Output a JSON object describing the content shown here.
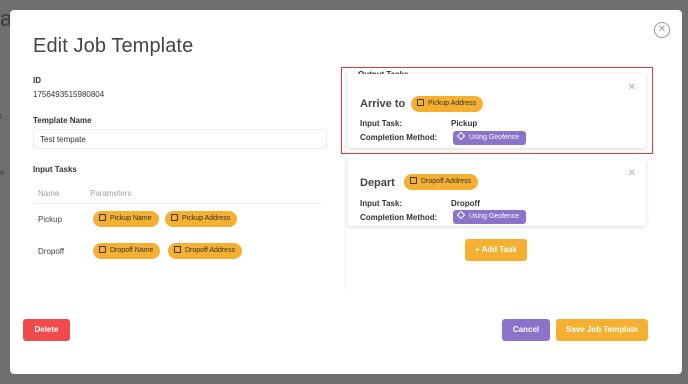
{
  "background": {
    "text_a": "a",
    "text_t": "t -",
    "text_e": "e"
  },
  "modal": {
    "title": "Edit Job Template",
    "close_icon": "close-circle-icon"
  },
  "form": {
    "id_label": "ID",
    "id_value": "1756493515980804",
    "template_name_label": "Template Name",
    "template_name_value": "Test tempate"
  },
  "input_tasks": {
    "label": "Input Tasks",
    "columns": [
      "Name",
      "Parameters"
    ],
    "rows": [
      {
        "name": "Pickup",
        "params": [
          "Pickup Name",
          "Pickup Address"
        ],
        "icons": [
          "building-icon",
          "building-icon"
        ]
      },
      {
        "name": "Dropoff",
        "params": [
          "Dropoff Name",
          "Dropoff Address"
        ],
        "icons": [
          "home-icon",
          "home-icon"
        ]
      }
    ]
  },
  "output_tasks": {
    "label": "Output Tasks",
    "cards": [
      {
        "title": "Arrive to",
        "chip": "Pickup Address",
        "input_task_label": "Input Task:",
        "input_task_value": "Pickup",
        "completion_label": "Completion Method:",
        "completion_value": "Using Geofence"
      },
      {
        "title": "Depart",
        "chip": "Dropoff Address",
        "input_task_label": "Input Task:",
        "input_task_value": "Dropoff",
        "completion_label": "Completion Method:",
        "completion_value": "Using Geofence"
      }
    ],
    "add_task_label": "+ Add Task"
  },
  "footer": {
    "delete_label": "Delete",
    "cancel_label": "Cancel",
    "save_label": "Save Job Template"
  },
  "colors": {
    "accent_orange": "#f5b031",
    "purple": "#8a73c8",
    "danger": "#f04a4a",
    "highlight": "#e53935"
  }
}
